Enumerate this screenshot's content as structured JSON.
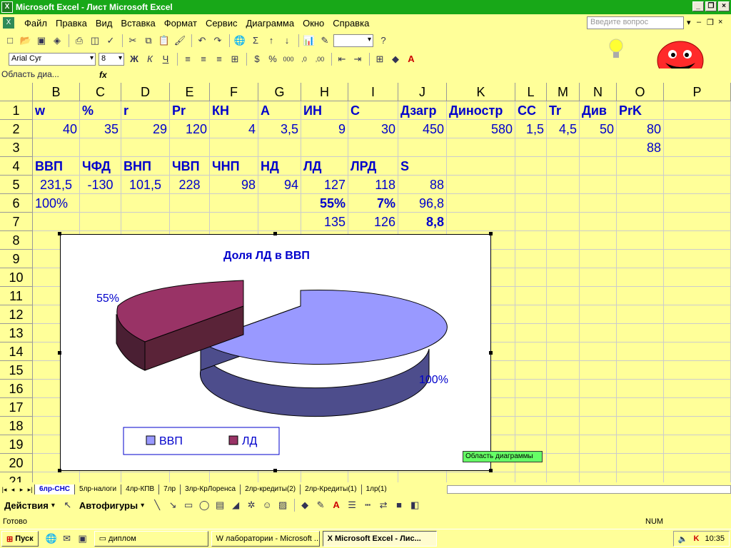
{
  "window": {
    "title": "Microsoft Excel - Лист Microsoft Excel",
    "app_icon": "excel-icon"
  },
  "menu": {
    "items": [
      "Файл",
      "Правка",
      "Вид",
      "Вставка",
      "Формат",
      "Сервис",
      "Диаграмма",
      "Окно",
      "Справка"
    ],
    "help_placeholder": "Введите вопрос"
  },
  "format_toolbar": {
    "font": "Arial Cyr",
    "size": "8"
  },
  "formula_bar": {
    "name_box": "Область диа...",
    "fx": "fx"
  },
  "columns": [
    "B",
    "C",
    "D",
    "E",
    "F",
    "G",
    "H",
    "I",
    "J",
    "K",
    "L",
    "M",
    "N",
    "O",
    "P"
  ],
  "rows": [
    "1",
    "2",
    "3",
    "4",
    "5",
    "6",
    "7",
    "8",
    "9",
    "10",
    "11",
    "12",
    "13",
    "14",
    "15",
    "16",
    "17",
    "18",
    "19",
    "20",
    "21"
  ],
  "cells": {
    "r1": [
      "w",
      "%",
      "r",
      "Pr",
      "КН",
      "А",
      "ИН",
      "С",
      "Дзагр",
      "Диностр",
      "СС",
      "Tr",
      "Див",
      "PrK"
    ],
    "r2": [
      "40",
      "35",
      "29",
      "120",
      "4",
      "3,5",
      "9",
      "30",
      "450",
      "580",
      "1,5",
      "4,5",
      "50",
      "80"
    ],
    "r3_o": "88",
    "r4": [
      "ВВП",
      "ЧФД",
      "ВНП",
      "ЧВП",
      "ЧНП",
      "НД",
      "ЛД",
      "ЛРД",
      "S"
    ],
    "r5": [
      "231,5",
      "-130",
      "101,5",
      "228",
      "98",
      "94",
      "127",
      "118",
      "88"
    ],
    "r6_b": "100%",
    "r6_h": "55%",
    "r6_i": "7%",
    "r6_j": "96,8",
    "r7_h": "135",
    "r7_i": "126",
    "r7_j": "8,8"
  },
  "chart_data": {
    "type": "pie",
    "title": "Доля ЛД в ВВП",
    "categories": [
      "ВВП",
      "ЛД"
    ],
    "values": [
      231.5,
      127
    ],
    "data_labels": [
      "100%",
      "55%"
    ],
    "colors": [
      "#9999ff",
      "#993366"
    ],
    "legend": "bottom-left",
    "exploded": true,
    "three_d": true
  },
  "tooltip": "Область диаграммы",
  "sheet_tabs": [
    "6лр-СНС",
    "5лр-налоги",
    "4лр-КПВ",
    "7лр",
    "3лр-КрЛоренса",
    "2лр-кредиты(2)",
    "2лр-Кредиты(1)",
    "1лр(1)"
  ],
  "draw_toolbar": {
    "actions": "Действия",
    "autoshapes": "Автофигуры"
  },
  "status": {
    "ready": "Готово",
    "num": "NUM"
  },
  "taskbar": {
    "start": "Пуск",
    "tasks": [
      "диплом",
      "лаборатории - Microsoft ...",
      "Microsoft Excel - Лис..."
    ],
    "clock": "10:35"
  }
}
